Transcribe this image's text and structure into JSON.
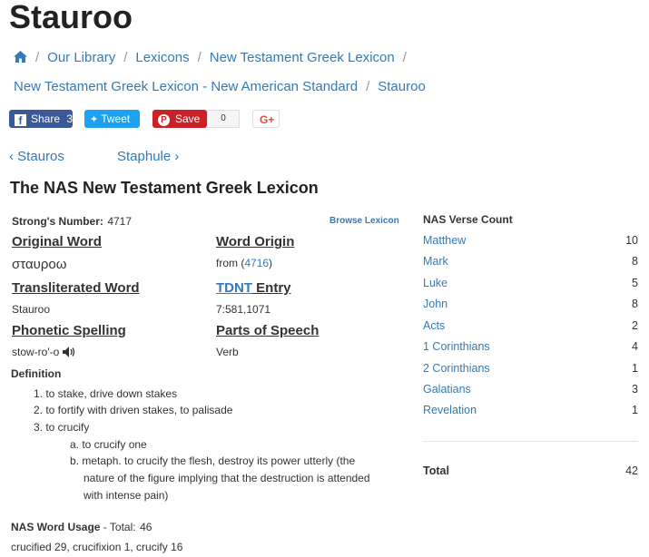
{
  "page": {
    "title": "Stauroo"
  },
  "breadcrumb": {
    "items": [
      "Our Library",
      "Lexicons",
      "New Testament Greek Lexicon",
      "New Testament Greek Lexicon - New American Standard",
      "Stauroo"
    ],
    "separator": "/"
  },
  "social": {
    "facebook_label": "Share",
    "facebook_count": "3",
    "twitter_label": "Tweet",
    "pinterest_label": "Save",
    "pinterest_count": "0",
    "google_label": "G+"
  },
  "nav": {
    "prev": "‹ Stauros",
    "next": "Staphule ›"
  },
  "lexicon": {
    "heading": "The NAS New Testament Greek Lexicon",
    "strongs_label": "Strong's Number:",
    "strongs_value": "4717",
    "browse_link": "Browse Lexicon",
    "original_word_label": "Original Word",
    "original_word_value": "σταυροω",
    "word_origin_label": "Word Origin",
    "word_origin_prefix": "from (",
    "word_origin_link": "4716",
    "word_origin_suffix": ")",
    "transliterated_label": "Transliterated Word",
    "transliterated_value": "Stauroo",
    "tdnt_link": "TDNT",
    "tdnt_suffix": " Entry",
    "tdnt_value": "7:581,1071",
    "phonetic_label": "Phonetic Spelling",
    "phonetic_value": "stow-ro'-o",
    "pos_label": "Parts of Speech",
    "pos_value": "Verb",
    "definition_label": "Definition",
    "definitions": [
      "1. to stake, drive down stakes",
      "2. to fortify with driven stakes, to palisade",
      "3. to crucify",
      "a. to crucify one",
      "b. metaph. to crucify the flesh, destroy its power utterly (the",
      "nature of the figure implying that the destruction is attended",
      "with intense pain)"
    ],
    "usage_label": "NAS Word Usage",
    "usage_total_label": " - Total:",
    "usage_total": "46",
    "usage_text": "crucified 29, crucifixion 1, crucify 16"
  },
  "verse_count": {
    "heading": "NAS Verse Count",
    "books": [
      {
        "name": "Matthew",
        "count": "10"
      },
      {
        "name": "Mark",
        "count": "8"
      },
      {
        "name": "Luke",
        "count": "5"
      },
      {
        "name": "John",
        "count": "8"
      },
      {
        "name": "Acts",
        "count": "2"
      },
      {
        "name": "1 Corinthians",
        "count": "4"
      },
      {
        "name": "2 Corinthians",
        "count": "1"
      },
      {
        "name": "Galatians",
        "count": "3"
      },
      {
        "name": "Revelation",
        "count": "1"
      }
    ],
    "total_label": "Total",
    "total_value": "42"
  },
  "icons": {
    "home": "home-icon",
    "speaker": "speaker-icon",
    "facebook": "facebook-icon",
    "twitter": "twitter-icon",
    "pinterest": "pinterest-icon"
  }
}
